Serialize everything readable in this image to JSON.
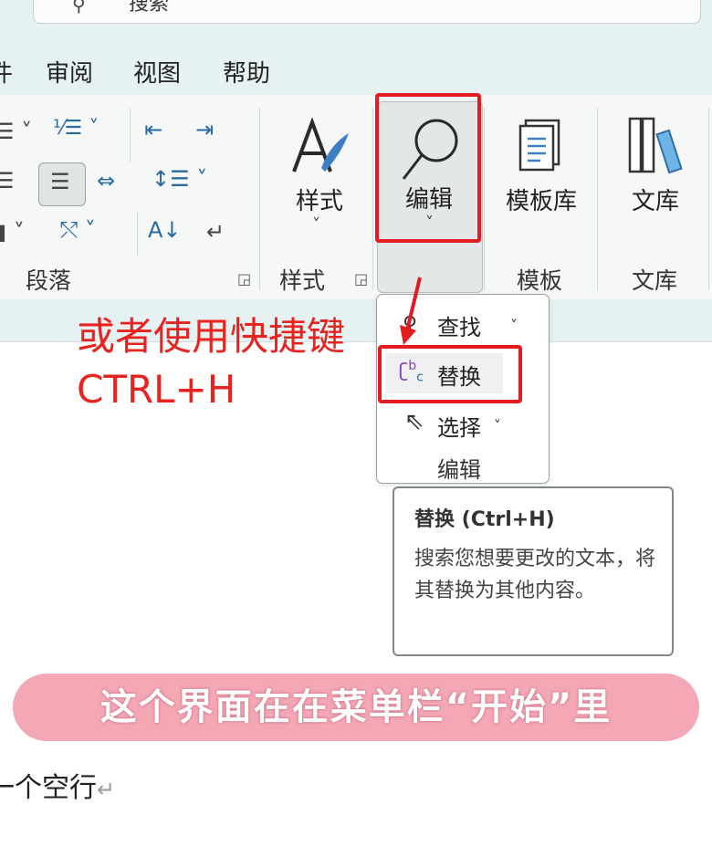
{
  "search": {
    "placeholder": "搜索"
  },
  "tabs": [
    {
      "label": "件"
    },
    {
      "label": "审阅"
    },
    {
      "label": "视图"
    },
    {
      "label": "帮助"
    }
  ],
  "ribbon": {
    "paragraph_group": {
      "label": "段落"
    },
    "styles_group": {
      "label": "样式",
      "button_label": "样式"
    },
    "edit_group": {
      "button_label": "编辑"
    },
    "template_group": {
      "label": "模板",
      "button_label": "模板库"
    },
    "library_group": {
      "label": "文库",
      "button_label": "文库"
    }
  },
  "edit_menu": {
    "items": [
      {
        "label": "查找",
        "icon": "search-icon"
      },
      {
        "label": "替换",
        "icon": "replace-icon"
      },
      {
        "label": "选择",
        "icon": "cursor-icon"
      }
    ],
    "footer_label": "编辑"
  },
  "tooltip": {
    "title": "替换 (Ctrl+H)",
    "body": "搜索您想要更改的文本，将其替换为其他内容。"
  },
  "annotation": {
    "line1": "或者使用快捷键",
    "line2": "CTRL+H",
    "color": "#e8231f"
  },
  "banner": {
    "text": "这个界面在在菜单栏“开始”里",
    "color": "#f4a7b5"
  },
  "document": {
    "line": "一个空行",
    "return_mark": "↵"
  },
  "colors": {
    "highlight_box": "#e21c20",
    "ribbon_bg": "#f6f8f8",
    "top_bg": "#e6f1f2"
  }
}
